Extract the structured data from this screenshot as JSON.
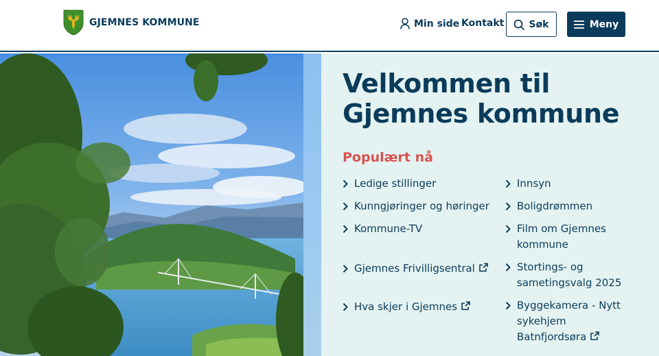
{
  "header": {
    "logo_text": "GJEMNES KOMMUNE",
    "min_side": "Min side",
    "kontakt": "Kontakt",
    "search_label": "Søk",
    "menu_label": "Meny"
  },
  "hero": {
    "title": "Velkommen til Gjemnes kommune"
  },
  "popular": {
    "title": "Populært nå",
    "left_links": [
      {
        "label": "Ledige stillinger",
        "external": false
      },
      {
        "label": "Kunngjøringer og høringer",
        "external": false
      },
      {
        "label": "Kommune-TV",
        "external": false
      },
      {
        "label": "Gjemnes Frivilligsentral",
        "external": true
      },
      {
        "label": "Hva skjer i Gjemnes",
        "external": true
      }
    ],
    "right_links": [
      {
        "label": "Innsyn",
        "external": false
      },
      {
        "label": "Boligdrømmen",
        "external": false
      },
      {
        "label": "Film om Gjemnes kommune",
        "external": false
      },
      {
        "label": "Stortings- og sametingsvalg 2025",
        "external": false
      },
      {
        "label": "Byggekamera - Nytt sykehjem Batnfjordsøra",
        "external": true
      }
    ]
  },
  "icons": {
    "logo": "coat-of-arms-moose-icon",
    "min_side": "person-icon",
    "search": "search-icon",
    "menu": "hamburger-icon",
    "chevron": "chevron-right-icon",
    "external": "external-link-icon"
  },
  "colors": {
    "primary": "#0b3b5a",
    "accent": "#d9534f",
    "panel_bg": "#e4f3f1",
    "logo_green": "#3f8f2a",
    "logo_gold": "#e6b422"
  }
}
